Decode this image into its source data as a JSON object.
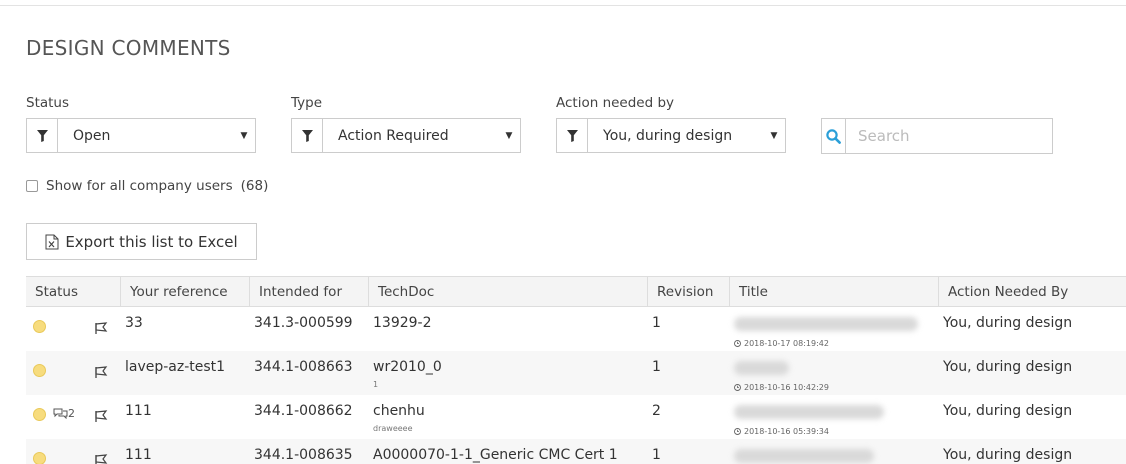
{
  "page": {
    "title": "DESIGN COMMENTS"
  },
  "filters": {
    "status": {
      "label": "Status",
      "value": "Open"
    },
    "type": {
      "label": "Type",
      "value": "Action Required"
    },
    "action_needed_by": {
      "label": "Action needed by",
      "value": "You, during design"
    },
    "search": {
      "placeholder": "Search",
      "value": ""
    }
  },
  "show_all": {
    "label": "Show for all company users",
    "count": "(68)",
    "checked": false
  },
  "export": {
    "label": "Export this list to Excel"
  },
  "table": {
    "columns": [
      "Status",
      "Your reference",
      "Intended for",
      "TechDoc",
      "Revision",
      "Title",
      "Action Needed By"
    ],
    "rows": [
      {
        "status_color": "#f7dc7e",
        "comments": "",
        "reference": "33",
        "intended_for": "341.3-000599",
        "techdoc": "13929-2",
        "techdoc_sub": "",
        "revision": "1",
        "timestamp": "2018-10-17 08:19:42",
        "action_needed_by": "You, during design"
      },
      {
        "status_color": "#f7dc7e",
        "comments": "",
        "reference": "lavep-az-test1",
        "intended_for": "344.1-008663",
        "techdoc": "wr2010_0",
        "techdoc_sub": "1",
        "revision": "1",
        "timestamp": "2018-10-16 10:42:29",
        "action_needed_by": "You, during design"
      },
      {
        "status_color": "#f7dc7e",
        "comments": "2",
        "reference": "111",
        "intended_for": "344.1-008662",
        "techdoc": "chenhu",
        "techdoc_sub": "draweeee",
        "revision": "2",
        "timestamp": "2018-10-16 05:39:34",
        "action_needed_by": "You, during design"
      },
      {
        "status_color": "#f7dc7e",
        "comments": "",
        "reference": "111",
        "intended_for": "344.1-008635",
        "techdoc": "A0000070-1-1_Generic CMC Cert 1",
        "techdoc_sub": "",
        "revision": "1",
        "timestamp": "",
        "action_needed_by": "You, during design"
      }
    ]
  },
  "icons": {
    "filter": "filter-icon",
    "caret": "caret-down-icon",
    "search": "search-icon",
    "excel": "excel-file-icon",
    "flag": "flag-icon",
    "comment": "comment-icon",
    "clock": "clock-icon"
  },
  "colors": {
    "accent": "#2a9fd8",
    "status_open": "#f7dc7e"
  }
}
